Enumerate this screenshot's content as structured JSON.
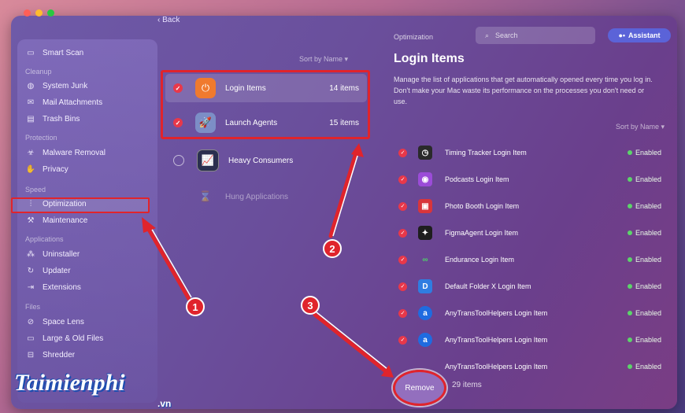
{
  "sidebar": {
    "items": [
      {
        "key": "smart-scan",
        "label": "Smart Scan",
        "icon": "monitor-icon"
      },
      {
        "key": "system-junk",
        "label": "System Junk",
        "icon": "junk-icon"
      },
      {
        "key": "mail-attachments",
        "label": "Mail Attachments",
        "icon": "mail-icon"
      },
      {
        "key": "trash-bins",
        "label": "Trash Bins",
        "icon": "trash-icon"
      },
      {
        "key": "malware-removal",
        "label": "Malware Removal",
        "icon": "biohazard-icon"
      },
      {
        "key": "privacy",
        "label": "Privacy",
        "icon": "hand-icon"
      },
      {
        "key": "optimization",
        "label": "Optimization",
        "icon": "sliders-icon"
      },
      {
        "key": "maintenance",
        "label": "Maintenance",
        "icon": "wrench-icon"
      },
      {
        "key": "uninstaller",
        "label": "Uninstaller",
        "icon": "uninstall-icon"
      },
      {
        "key": "updater",
        "label": "Updater",
        "icon": "update-icon"
      },
      {
        "key": "extensions",
        "label": "Extensions",
        "icon": "extensions-icon"
      },
      {
        "key": "space-lens",
        "label": "Space Lens",
        "icon": "lens-icon"
      },
      {
        "key": "large-old-files",
        "label": "Large & Old Files",
        "icon": "folder-icon"
      },
      {
        "key": "shredder",
        "label": "Shredder",
        "icon": "shredder-icon"
      }
    ],
    "sections": {
      "cleanup": "Cleanup",
      "protection": "Protection",
      "speed": "Speed",
      "applications": "Applications",
      "files": "Files"
    }
  },
  "middle": {
    "back_label": "Back",
    "sort_label": "Sort by Name ▾",
    "rows": [
      {
        "label": "Login Items",
        "count": "14 items",
        "checked": true
      },
      {
        "label": "Launch Agents",
        "count": "15 items",
        "checked": true
      },
      {
        "label": "Heavy Consumers",
        "count": "",
        "checked": false
      },
      {
        "label": "Hung Applications",
        "count": "",
        "checked": false
      }
    ]
  },
  "header": {
    "section": "Optimization",
    "search_placeholder": "Search",
    "assistant_label": "Assistant"
  },
  "detail": {
    "title": "Login Items",
    "description": "Manage the list of applications that get automatically opened every time you log in. Don't make your Mac waste its performance on the processes you don't need or use.",
    "sort_label": "Sort by Name ▾",
    "items": [
      {
        "name": "Timing Tracker Login Item",
        "status": "Enabled"
      },
      {
        "name": "Podcasts Login Item",
        "status": "Enabled"
      },
      {
        "name": "Photo Booth Login Item",
        "status": "Enabled"
      },
      {
        "name": "FigmaAgent Login Item",
        "status": "Enabled"
      },
      {
        "name": "Endurance Login Item",
        "status": "Enabled"
      },
      {
        "name": "Default Folder X Login Item",
        "status": "Enabled"
      },
      {
        "name": "AnyTransToolHelpers Login Item",
        "status": "Enabled"
      },
      {
        "name": "AnyTransToolHelpers Login Item",
        "status": "Enabled"
      },
      {
        "name": "AnyTransToolHelpers Login Item",
        "status": "Enabled"
      }
    ],
    "remove_label": "Remove",
    "total_label": "29 items"
  },
  "annotations": {
    "badge1": "1",
    "badge2": "2",
    "badge3": "3",
    "accent": "#e0242c"
  },
  "watermark": {
    "brand": "Taimienphi",
    "suffix": ".vn"
  }
}
